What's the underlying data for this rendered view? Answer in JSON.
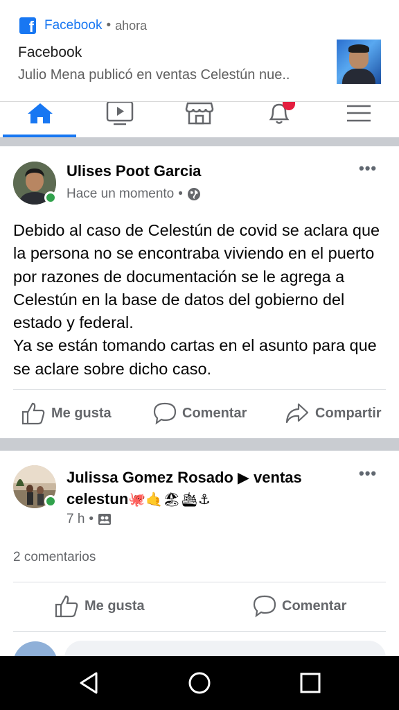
{
  "notification": {
    "app_name": "Facebook",
    "separator": "•",
    "time": "ahora",
    "title": "Facebook",
    "text": "Julio Mena publicó en ventas Celestún nue.."
  },
  "nav": {
    "items": [
      "home-icon",
      "video-icon",
      "marketplace-icon",
      "notifications-icon",
      "menu-icon"
    ],
    "active": "home-icon",
    "notification_badge": "",
    "accent_color": "#1877f2",
    "badge_color": "#e41e3f"
  },
  "posts": [
    {
      "author": "Ulises Poot Garcia",
      "time": "Hace un momento",
      "separator": "•",
      "privacy_icon": "globe-icon",
      "more": "•••",
      "body": "Debido al caso de Celestún de covid se aclara que la persona no se encontraba viviendo en el puerto   por razones de documentación se le agrega a Celestún en la base de datos del gobierno del estado y federal.\nYa se están tomando cartas en el asunto para que se aclare sobre dicho caso.",
      "actions": [
        "Me gusta",
        "Comentar",
        "Compartir"
      ]
    },
    {
      "author": "Julissa Gomez Rosado",
      "group_arrow": "▶",
      "group_line1": "ventas",
      "group_line2": "celestun",
      "group_emoji": "🐙🤙🏖🛳⚓",
      "time": "7 h",
      "separator": "•",
      "privacy_icon": "group-icon",
      "more": "•••",
      "comments": "2 comentarios",
      "actions": [
        "Me gusta",
        "Comentar"
      ]
    }
  ],
  "colors": {
    "secondary_text": "#65676b",
    "online": "#31a24c",
    "divider": "#c9ccd1"
  }
}
